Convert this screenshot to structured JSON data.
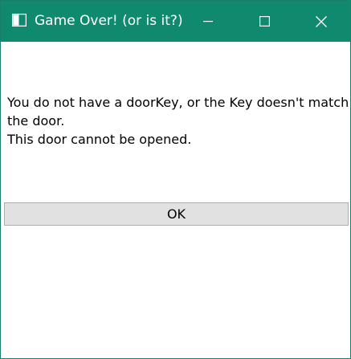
{
  "window": {
    "title": "Game Over! (or is it?)",
    "controls": {
      "minimize_icon": "minimize-icon",
      "maximize_icon": "maximize-icon",
      "close_icon": "close-icon"
    },
    "accent_color": "#0f8a6f"
  },
  "dialog": {
    "message_lines": [
      "You do not have a doorKey, or the Key doesn't match",
      "the door.",
      "This door cannot be opened."
    ],
    "ok_label": "OK"
  }
}
